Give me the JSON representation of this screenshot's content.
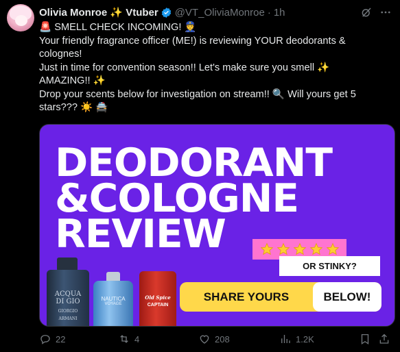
{
  "post": {
    "display_name": "Olivia Monroe ✨ Vtuber",
    "handle": "@VT_OliviaMonroe",
    "separator": "·",
    "time": "1h",
    "lines": [
      "🚨 SMELL CHECK INCOMING! 👮",
      "Your friendly fragrance officer (ME!) is reviewing YOUR deodorants & colognes!",
      "Just in time for convention season!! Let's make sure you smell ✨ AMAZING!! ✨",
      "Drop your scents below for investigation on stream!! 🔍 Will yours get 5 stars??? ☀️ 🚔"
    ]
  },
  "media": {
    "title_lines": [
      "DEODORANT",
      "&COLOGNE",
      "REVIEW"
    ],
    "rating_stars": 5,
    "stinky_text": "OR STINKY?",
    "share_text": "SHARE YOURS",
    "below_text": "BELOW!",
    "bottle1_label": "ACQUA DI GIO",
    "bottle1_sublabel": "GIORGIO ARMANI",
    "bottle2_label": "NAUTICA",
    "bottle2_sublabel": "VOYAGE",
    "stick_label": "Old Spice",
    "stick_sublabel": "CAPTAIN"
  },
  "actions": {
    "replies": "22",
    "reposts": "4",
    "likes": "208",
    "views": "1.2K"
  },
  "icons": [
    "verified-icon",
    "grok-icon",
    "more-icon",
    "reply-icon",
    "repost-icon",
    "like-icon",
    "views-icon",
    "bookmark-icon",
    "share-icon",
    "star-icon"
  ],
  "colors": {
    "background": "#000000",
    "text": "#e7e9ea",
    "muted": "#71767b",
    "verified": "#1d9bf0",
    "media_purple": "#6a22e6",
    "media_pink": "#ff74d0",
    "media_yellow": "#ffd84a"
  }
}
